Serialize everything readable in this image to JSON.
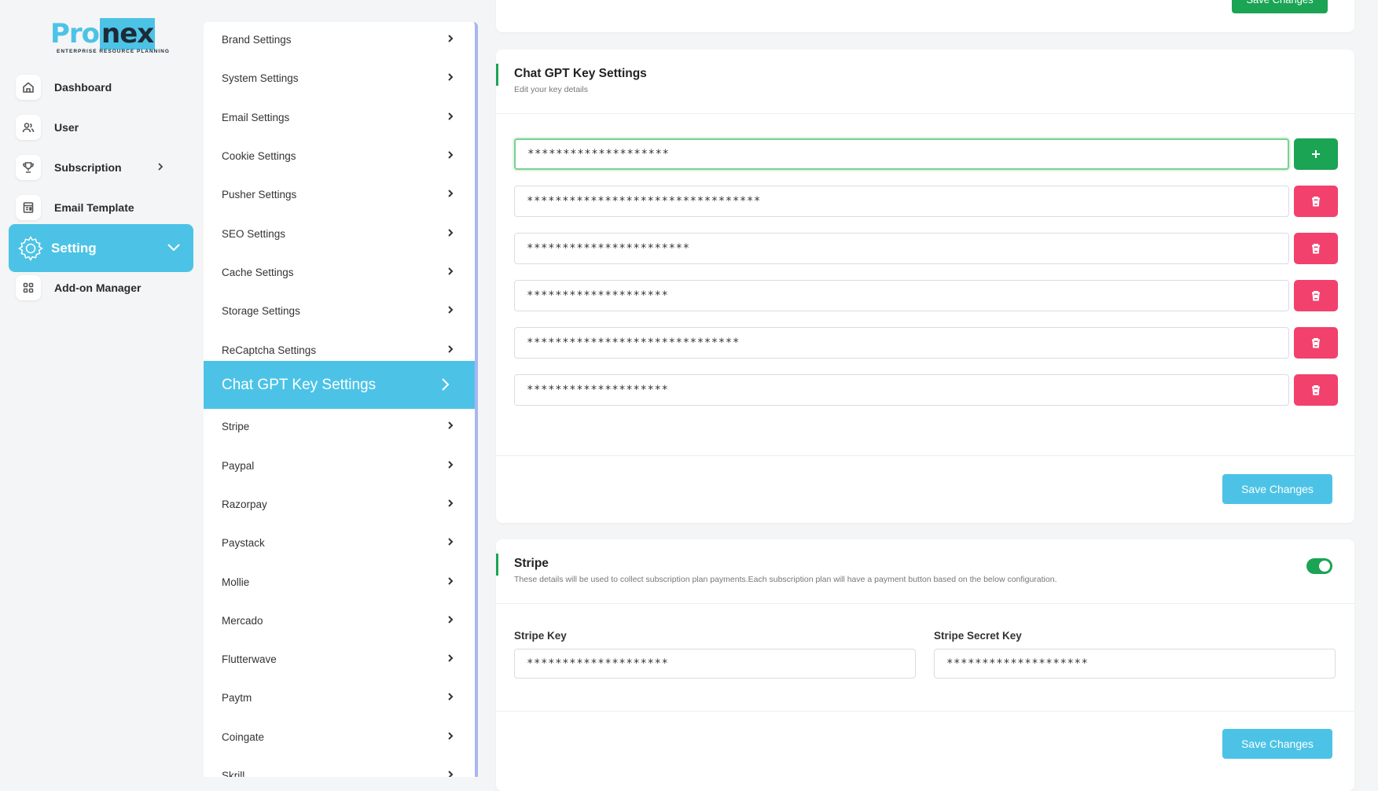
{
  "brand": {
    "logo_main": "Pro",
    "logo_nex": "nex",
    "tagline": "ENTERPRISE RESOURCE PLANNING"
  },
  "nav": {
    "items": [
      {
        "label": "Dashboard",
        "icon": "home-icon"
      },
      {
        "label": "User",
        "icon": "users-icon"
      },
      {
        "label": "Subscription",
        "icon": "trophy-icon"
      },
      {
        "label": "Email Template",
        "icon": "template-icon"
      },
      {
        "label": "Setting",
        "icon": "gear-icon"
      },
      {
        "label": "Add-on Manager",
        "icon": "grid-icon"
      }
    ]
  },
  "settings_list": [
    "Brand Settings",
    "System Settings",
    "Email Settings",
    "Cookie Settings",
    "Pusher Settings",
    "SEO Settings",
    "Cache Settings",
    "Storage Settings",
    "ReCaptcha Settings",
    "Chat GPT Key Settings",
    "Stripe",
    "Paypal",
    "Razorpay",
    "Paystack",
    "Mollie",
    "Mercado",
    "Flutterwave",
    "Paytm",
    "Coingate",
    "Skrill"
  ],
  "top_card": {
    "save_label": "Save Changes"
  },
  "chatgpt": {
    "title": "Chat GPT Key Settings",
    "subtitle": "Edit your key details",
    "keys": [
      "********************",
      "*********************************",
      "***********************",
      "********************",
      "******************************",
      "********************"
    ],
    "save_label": "Save Changes"
  },
  "stripe": {
    "title": "Stripe",
    "subtitle": "These details will be used to collect subscription plan payments.Each subscription plan will have a payment button based on the below configuration.",
    "enabled": true,
    "key_label": "Stripe Key",
    "key_value": "********************",
    "secret_label": "Stripe Secret Key",
    "secret_value": "********************",
    "save_label": "Save Changes"
  },
  "colors": {
    "accent": "#4cc3e6",
    "success": "#1aa453",
    "danger": "#f1416c"
  }
}
